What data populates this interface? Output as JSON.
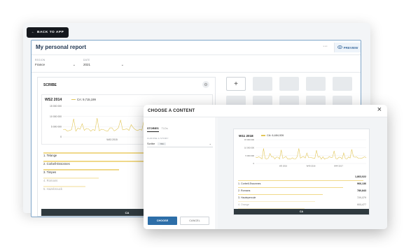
{
  "app": {
    "back_label": "BACK TO APP",
    "report_title": "My personal report",
    "more_label": "···",
    "preview_label": "PREVIEW",
    "filters": [
      {
        "label": "REGION",
        "value": "France"
      },
      {
        "label": "DATE",
        "value": "2021"
      }
    ],
    "scribe_card": {
      "title": "SCRIBE",
      "chart": {
        "heading": "WS2 2014",
        "legend": "CA: 9,715,199",
        "y_ticks": [
          "15 000 000",
          "10 000 000",
          "5 000 000",
          "0"
        ],
        "x_ticks": [
          "W43 2015",
          "W10 2018"
        ]
      },
      "list": [
        {
          "label": "1. Telange",
          "fraction": 0.85
        },
        {
          "label": "2. Corbell-Essonnes",
          "fraction": 0.62
        },
        {
          "label": "3. Timpes",
          "fraction": 0.45
        },
        {
          "label": "4. Romans",
          "fraction": 0.33
        },
        {
          "label": "5. Hazebrouck",
          "fraction": 0.25
        }
      ],
      "footer": "CA"
    },
    "add_tile_label": "+"
  },
  "modal": {
    "title": "CHOOSE A CONTENT",
    "close_label": "×",
    "tabs": [
      "STORIES",
      "TLDs"
    ],
    "choose_story_label": "CHOOSE A STORY",
    "story_value": "Scribe",
    "story_badge": "TBD",
    "choose_button": "CHOOSE",
    "cancel_button": "CANCEL",
    "preview": {
      "heading": "W11 2018",
      "legend": "CA: 6,484,926",
      "y_ticks": [
        "15 000 000",
        "10 000 000",
        "5 000 000",
        "0"
      ],
      "x_ticks": [
        "W5 2016",
        "W49 2016",
        "W44 2017"
      ],
      "list": [
        {
          "label": "1. Corbell-Essonnes",
          "value": "1,863,022",
          "fraction": 0.98
        },
        {
          "label": "2. Romans",
          "value": "966,136",
          "fraction": 0.82
        },
        {
          "label": "3. Hautepercule",
          "value": "780,843",
          "fraction": 0.66
        },
        {
          "label": "4. Orange",
          "value": "720,379",
          "fraction": 0.6
        },
        {
          "label": "5. Villefranche",
          "value": "663,477",
          "fraction": 0.52
        }
      ],
      "footer": "CA"
    }
  },
  "colors": {
    "accent": "#2d6ea8",
    "series": "#e2c75a",
    "dark": "#15181d",
    "footer": "#2f3a3f"
  }
}
